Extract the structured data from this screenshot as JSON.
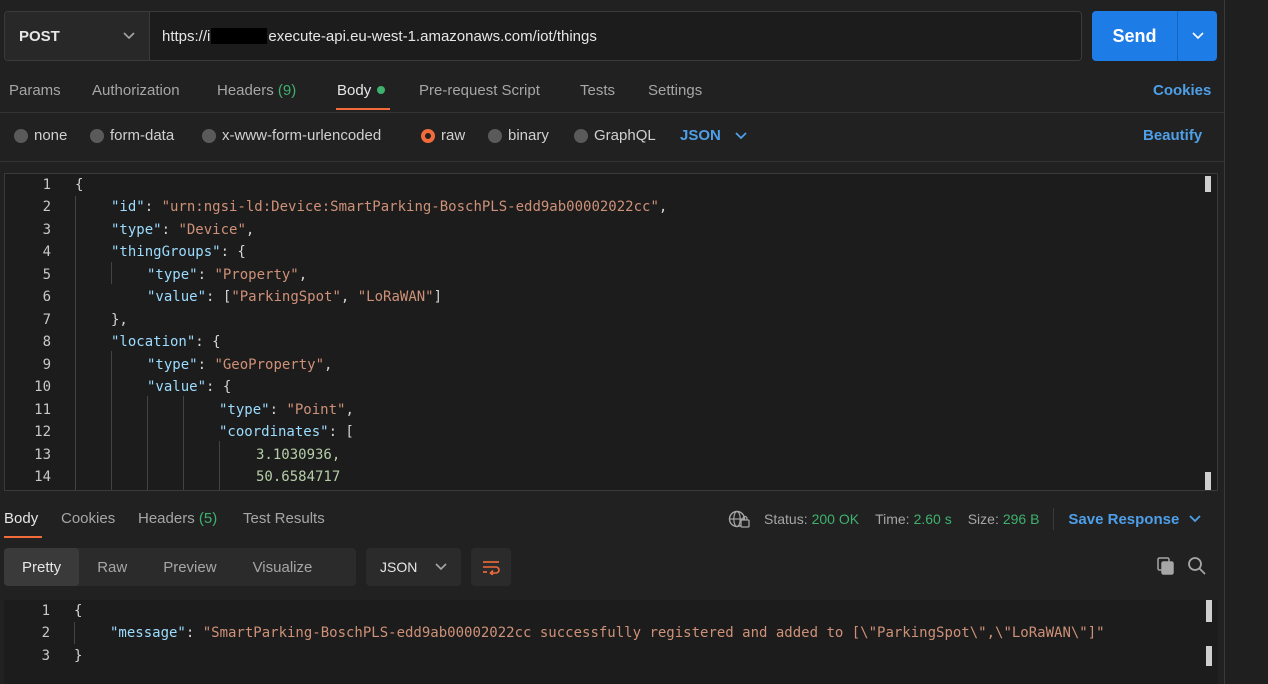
{
  "request": {
    "method": "POST",
    "url_prefix": "https://i",
    "url_suffix": "execute-api.eu-west-1.amazonaws.com/iot/things",
    "send_label": "Send"
  },
  "req_tabs": {
    "params": "Params",
    "authorization": "Authorization",
    "headers": "Headers",
    "headers_count": "(9)",
    "body": "Body",
    "prerequest": "Pre-request Script",
    "tests": "Tests",
    "settings": "Settings",
    "cookies": "Cookies"
  },
  "body_types": {
    "none": "none",
    "form_data": "form-data",
    "urlencoded": "x-www-form-urlencoded",
    "raw": "raw",
    "binary": "binary",
    "graphql": "GraphQL",
    "format": "JSON",
    "beautify": "Beautify"
  },
  "request_body": {
    "line_numbers": [
      "1",
      "2",
      "3",
      "4",
      "5",
      "6",
      "7",
      "8",
      "9",
      "10",
      "11",
      "12",
      "13",
      "14"
    ],
    "id_key": "\"id\"",
    "id_value": "\"urn:ngsi-ld:Device:SmartParking-BoschPLS-edd9ab00002022cc\"",
    "type_key": "\"type\"",
    "type_value": "\"Device\"",
    "thing_groups_key": "\"thingGroups\"",
    "tg_type_value": "\"Property\"",
    "value_key": "\"value\"",
    "tg_value_1": "\"ParkingSpot\"",
    "tg_value_2": "\"LoRaWAN\"",
    "location_key": "\"location\"",
    "loc_type_value": "\"GeoProperty\"",
    "point_value": "\"Point\"",
    "coordinates_key": "\"coordinates\"",
    "coord_1": "3.1030936,",
    "coord_2": "50.6584717"
  },
  "response_tabs": {
    "body": "Body",
    "cookies": "Cookies",
    "headers": "Headers",
    "headers_count": "(5)",
    "test_results": "Test Results"
  },
  "status": {
    "status_label": "Status:",
    "status_value": "200 OK",
    "time_label": "Time:",
    "time_value": "2.60 s",
    "size_label": "Size:",
    "size_value": "296 B",
    "save_response": "Save Response"
  },
  "response_view": {
    "pretty": "Pretty",
    "raw": "Raw",
    "preview": "Preview",
    "visualize": "Visualize",
    "format": "JSON"
  },
  "response_body": {
    "line_numbers": [
      "1",
      "2",
      "3"
    ],
    "message_key": "\"message\"",
    "message_value": "\"SmartParking-BoschPLS-edd9ab00002022cc successfully registered and added to [\\\"ParkingSpot\\\",\\\"LoRaWAN\\\"]\""
  },
  "colors": {
    "accent_orange": "#f26b3a",
    "link_blue": "#4e9fe8",
    "send_blue": "#1e7ce6",
    "success_green": "#3fb16e"
  }
}
